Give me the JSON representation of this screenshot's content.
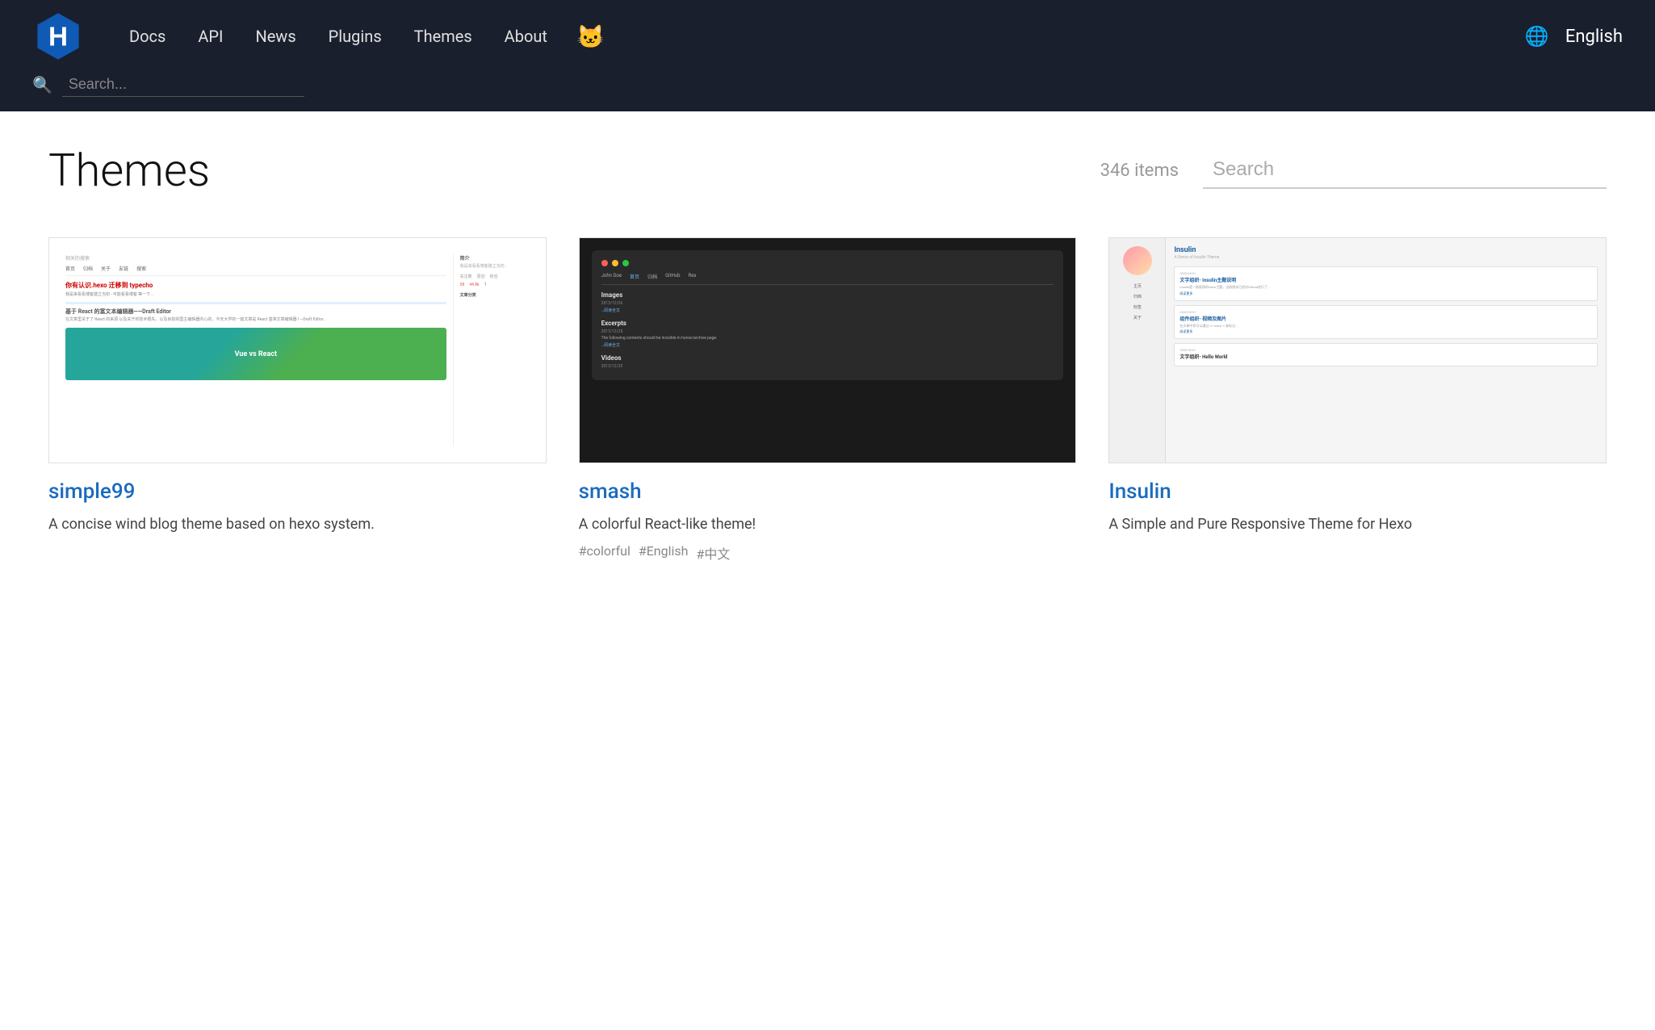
{
  "header": {
    "nav": [
      {
        "label": "Docs",
        "id": "docs"
      },
      {
        "label": "API",
        "id": "api"
      },
      {
        "label": "News",
        "id": "news"
      },
      {
        "label": "Plugins",
        "id": "plugins"
      },
      {
        "label": "Themes",
        "id": "themes"
      },
      {
        "label": "About",
        "id": "about"
      }
    ],
    "search_placeholder": "Search...",
    "lang": "English",
    "logo_alt": "Hexo"
  },
  "page": {
    "title": "Themes",
    "items_count": "346 items",
    "search_placeholder": "Search"
  },
  "themes": [
    {
      "id": "simple99",
      "name": "simple99",
      "description": "A concise wind blog theme based on hexo system.",
      "tags": []
    },
    {
      "id": "smash",
      "name": "smash",
      "description": "A colorful React-like theme!",
      "tags": [
        "#colorful",
        "#English",
        "#中文"
      ]
    },
    {
      "id": "insulin",
      "name": "Insulin",
      "description": "A Simple and Pure Responsive Theme for Hexo",
      "tags": []
    }
  ]
}
